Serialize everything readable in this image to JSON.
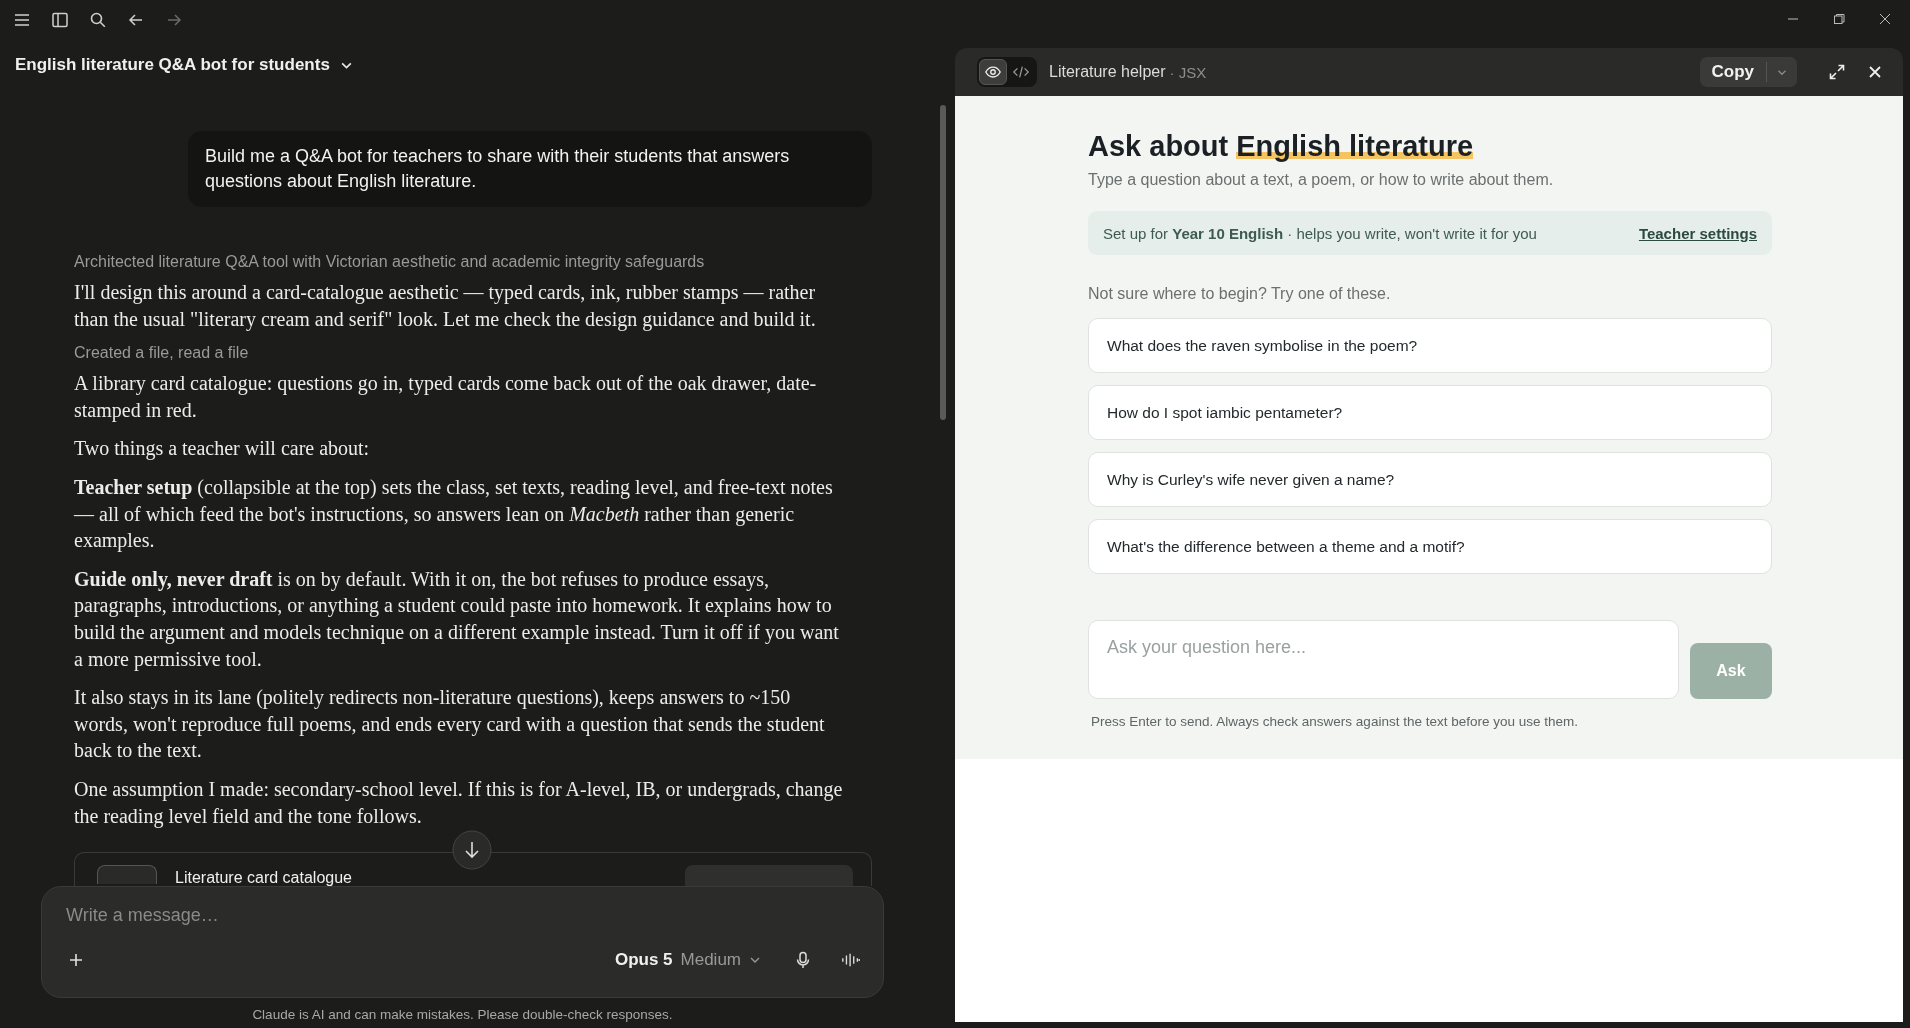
{
  "conversation": {
    "title": "English literature Q&A bot for students",
    "user_message": "Build me a Q&A bot for teachers to share with their students that answers questions about English literature.",
    "blocks": [
      {
        "kind": "summary",
        "text": "Architected literature Q&A tool with Victorian aesthetic and academic integrity safeguards"
      },
      {
        "kind": "paragraph",
        "text": "I'll design this around a card-catalogue aesthetic — typed cards, ink, rubber stamps — rather than the usual \"literary cream and serif\" look. Let me check the design guidance and build it."
      },
      {
        "kind": "summary",
        "text": "Created a file, read a file"
      },
      {
        "kind": "paragraph",
        "text": "A library card catalogue: questions go in, typed cards come back out of the oak drawer, date-stamped in red."
      },
      {
        "kind": "paragraph",
        "text": "Two things a teacher will care about:"
      },
      {
        "kind": "paragraph",
        "text": "**Teacher setup** (collapsible at the top) sets the class, set texts, reading level, and free-text notes — all of which feed the bot's instructions, so answers lean on *Macbeth* rather than generic examples."
      },
      {
        "kind": "paragraph",
        "text": "**Guide only, never draft** is on by default. With it on, the bot refuses to produce essays, paragraphs, introductions, or anything a student could paste into homework. It explains how to build the argument and models technique on a different example instead. Turn it off if you want a more permissive tool."
      },
      {
        "kind": "paragraph",
        "text": "It also stays in its lane (politely redirects non-literature questions), keeps answers to ~150 words, won't reproduce full poems, and ends every card with a question that sends the student back to the text."
      },
      {
        "kind": "paragraph",
        "text": "One assumption I made: secondary-school level. If this is for A-level, IB, or undergrads, change the reading level field and the tone follows."
      }
    ],
    "artifact_card": {
      "title": "Literature card catalogue"
    }
  },
  "composer": {
    "placeholder": "Write a message…",
    "model": "Opus 5",
    "effort": "Medium"
  },
  "disclaimer": "Claude is AI and can make mistakes. Please double-check responses.",
  "artifact": {
    "title": "Literature helper",
    "type": "· JSX",
    "modes": [
      {
        "kind": "preview",
        "selected": true
      },
      {
        "kind": "code",
        "selected": false
      }
    ],
    "copy_label": "Copy",
    "heading_lead": "Ask about ",
    "heading_highlight": "English literature",
    "subtitle": "Type a question about a text, a poem, or how to write about them.",
    "setup_note": "Set up for **Year 10 English** · helps you write, won't write it for you",
    "settings_link": "Teacher settings",
    "prompt_intro": "Not sure where to begin? Try one of these.",
    "suggestions": [
      "What does the raven symbolise in the poem?",
      "How do I spot iambic pentameter?",
      "Why is Curley's wife never given a name?",
      "What's the difference between a theme and a motif?"
    ],
    "question_placeholder": "Ask your question here...",
    "ask": {
      "label": "Ask",
      "disabled": true
    },
    "note": "Press Enter to send. Always check answers against the text before you use them."
  }
}
